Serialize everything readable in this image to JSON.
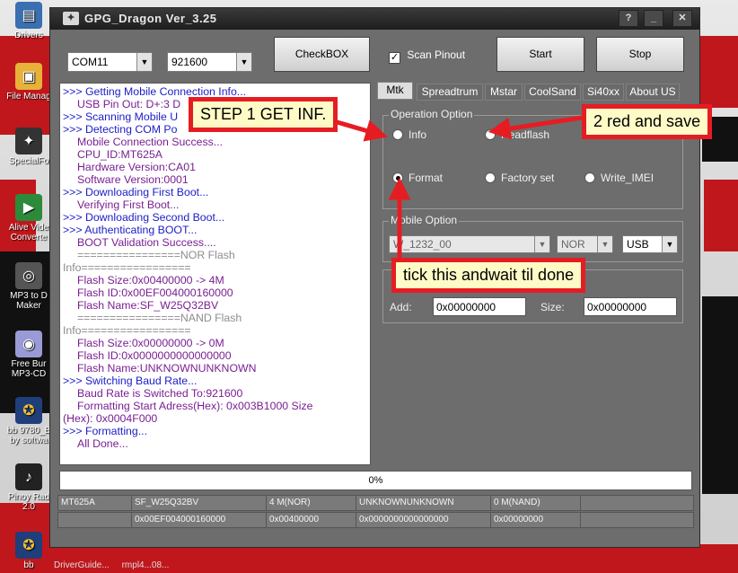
{
  "desktop": {
    "icons": [
      "Drivers",
      "File Manag",
      "SpecialFo",
      "Alive Vide Converte",
      "MP3 to D Maker",
      "Free Bur MP3-CD",
      "bb 9780_B by softwa",
      "Pinoy Rad 2.0",
      "bb"
    ],
    "taskbar_items": [
      "DriverGuide...",
      "rmpl4...08..."
    ]
  },
  "window": {
    "title": "GPG_Dragon  Ver_3.25",
    "com_port": "COM11",
    "baud_rate": "921600",
    "checkbox_button": "CheckBOX",
    "scan_pinout_label": "Scan Pinout",
    "scan_pinout_checked": true,
    "start_button": "Start",
    "stop_button": "Stop"
  },
  "log": [
    {
      "text": ">>> Getting Mobile Connection Info...",
      "style": "blue"
    },
    {
      "text": "USB Pin Out: D+:3  D",
      "style": "purple"
    },
    {
      "text": ">>> Scanning Mobile U",
      "style": "blue"
    },
    {
      "text": ">>> Detecting COM Po",
      "style": "blue"
    },
    {
      "text": "Mobile Connection Success...",
      "style": "purple"
    },
    {
      "text": "CPU_ID:MT625A",
      "style": "purple"
    },
    {
      "text": "Hardware Version:CA01",
      "style": "purple"
    },
    {
      "text": "Software Version:0001",
      "style": "purple"
    },
    {
      "text": ">>> Downloading First Boot...",
      "style": "blue"
    },
    {
      "text": "Verifying First Boot...",
      "style": "purple"
    },
    {
      "text": ">>> Downloading Second Boot...",
      "style": "blue"
    },
    {
      "text": ">>> Authenticating BOOT...",
      "style": "blue"
    },
    {
      "text": "BOOT Validation Success....",
      "style": "purple"
    },
    {
      "text": "================NOR Flash",
      "style": "grey-indent"
    },
    {
      "text": "Info=================",
      "style": "grey"
    },
    {
      "text": "Flash Size:0x00400000 -> 4M",
      "style": "purple"
    },
    {
      "text": "Flash ID:0x00EF004000160000",
      "style": "purple"
    },
    {
      "text": "Flash Name:SF_W25Q32BV",
      "style": "purple"
    },
    {
      "text": "================NAND Flash",
      "style": "grey-indent"
    },
    {
      "text": "Info=================",
      "style": "grey"
    },
    {
      "text": "Flash Size:0x00000000 -> 0M",
      "style": "purple"
    },
    {
      "text": "Flash ID:0x0000000000000000",
      "style": "purple"
    },
    {
      "text": "Flash Name:UNKNOWNUNKNOWN",
      "style": "purple"
    },
    {
      "text": ">>> Switching Baud Rate...",
      "style": "blue"
    },
    {
      "text": " Baud Rate is Switched To:921600",
      "style": "purple"
    },
    {
      "text": "Formatting Start Adress(Hex): 0x003B1000  Size",
      "style": "purple"
    },
    {
      "text": "(Hex): 0x0004F000",
      "style": "purple-noindent"
    },
    {
      "text": ">>> Formatting...",
      "style": "blue"
    },
    {
      "text": "All Done...",
      "style": "purple"
    }
  ],
  "tabs": [
    "Mtk",
    "Spreadtrum",
    "Mstar",
    "CoolSand",
    "Si40xx",
    "About US"
  ],
  "active_tab": "Mtk",
  "operation": {
    "group_label": "Operation Option",
    "info": "Info",
    "readflash": "Readflash",
    "format": "Format",
    "factory_set": "Factory set",
    "write_imei": "Write_IMEI",
    "selected": "Format"
  },
  "mobile": {
    "group_label": "Mobile Option",
    "model": "W_1232_00",
    "flash_type": "NOR",
    "connection": "USB"
  },
  "address": {
    "add_label": "Add:",
    "add_value": "0x00000000",
    "size_label": "Size:",
    "size_value": "0x00000000"
  },
  "progress": "0%",
  "status_row1": [
    "MT625A",
    "SF_W25Q32BV",
    "4 M(NOR)",
    "UNKNOWNUNKNOWN",
    "0 M(NAND)",
    ""
  ],
  "status_row2": [
    "",
    "0x00EF004000160000",
    "0x00400000",
    "0x0000000000000000",
    "0x00000000",
    ""
  ],
  "annotations": {
    "step1": "STEP 1 GET INF.",
    "step2": "2 red and save",
    "step3": "tick this andwait til done"
  },
  "colors": {
    "annotation_border": "#e51d23",
    "annotation_fill": "#fffbc6",
    "log_blue": "#1c1cc8",
    "log_purple": "#7a1f92"
  }
}
